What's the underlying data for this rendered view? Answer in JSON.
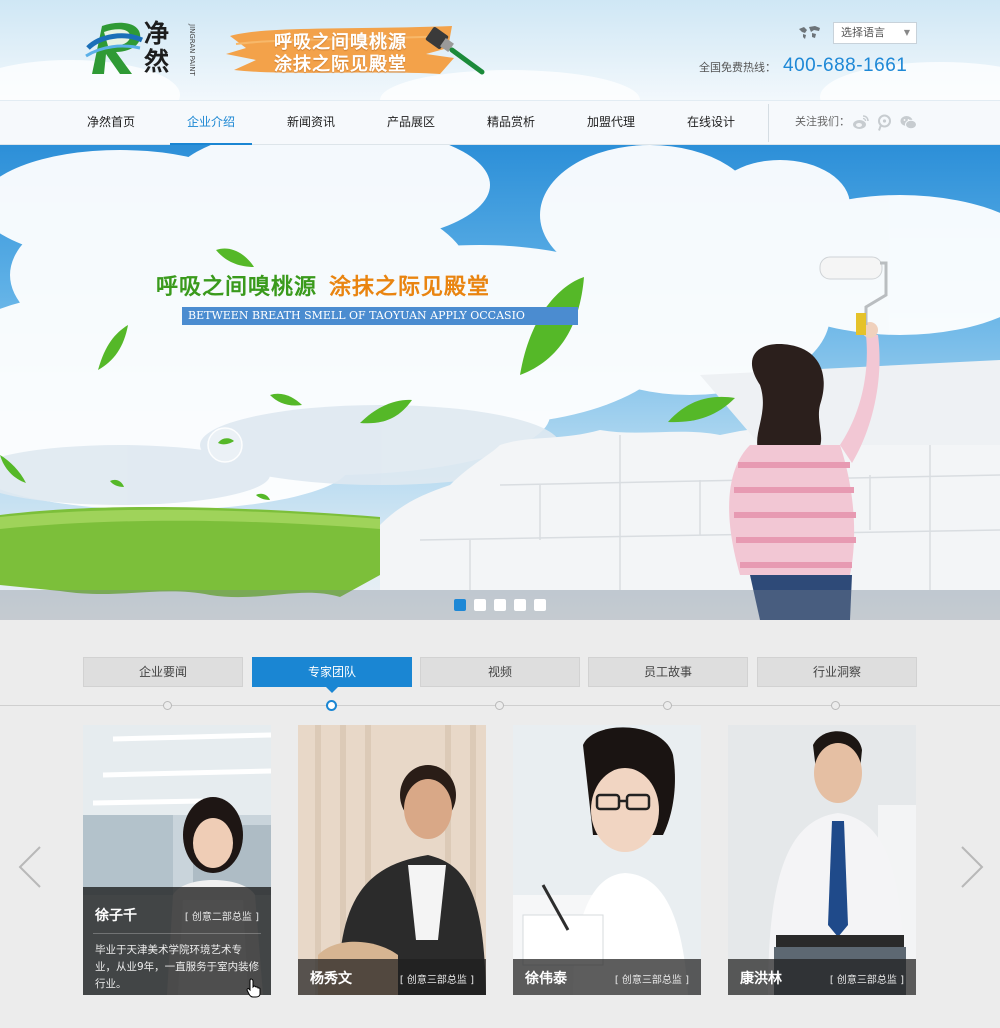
{
  "brand": {
    "logo_text": "净然",
    "logo_vertical": "JINGRAN PAINT",
    "slogan_line1": "呼吸之间嗅桃源",
    "slogan_line2": "涂抹之际见殿堂"
  },
  "header": {
    "language_select": "选择语言",
    "hotline_label": "全国免费热线：",
    "hotline_number": "400-688-1661"
  },
  "nav": {
    "items": [
      {
        "label": "净然首页",
        "active": false
      },
      {
        "label": "企业介绍",
        "active": true
      },
      {
        "label": "新闻资讯",
        "active": false
      },
      {
        "label": "产品展区",
        "active": false
      },
      {
        "label": "精品赏析",
        "active": false
      },
      {
        "label": "加盟代理",
        "active": false
      },
      {
        "label": "在线设计",
        "active": false
      }
    ],
    "follow_label": "关注我们：",
    "social_icons": [
      "weibo-icon",
      "tencent-weibo-icon",
      "wechat-icon"
    ]
  },
  "banner": {
    "headline_green": "呼吸之间嗅桃源",
    "headline_orange": "涂抹之际见殿堂",
    "subline": "BETWEEN BREATH SMELL OF TAOYUAN  APPLY OCCASIO",
    "slide_count": 5,
    "active_slide": 1
  },
  "tabs": {
    "items": [
      {
        "label": "企业要闻",
        "active": false
      },
      {
        "label": "专家团队",
        "active": true
      },
      {
        "label": "视频",
        "active": false
      },
      {
        "label": "员工故事",
        "active": false
      },
      {
        "label": "行业洞察",
        "active": false
      }
    ]
  },
  "team": {
    "members": [
      {
        "name": "徐子千",
        "role": "[ 创意二部总监 ]",
        "desc": "毕业于天津美术学院环境艺术专业，从业9年，一直服务于室内装修行业。",
        "expanded": true
      },
      {
        "name": "杨秀文",
        "role": "[ 创意三部总监 ]",
        "expanded": false
      },
      {
        "name": "徐伟泰",
        "role": "[ 创意三部总监 ]",
        "expanded": false
      },
      {
        "name": "康洪林",
        "role": "[ 创意三部总监 ]",
        "expanded": false
      }
    ]
  },
  "colors": {
    "accent": "#1a86d3",
    "hotline": "#1e88d6",
    "headline_green": "#3a9a1c",
    "headline_orange": "#e98410"
  }
}
